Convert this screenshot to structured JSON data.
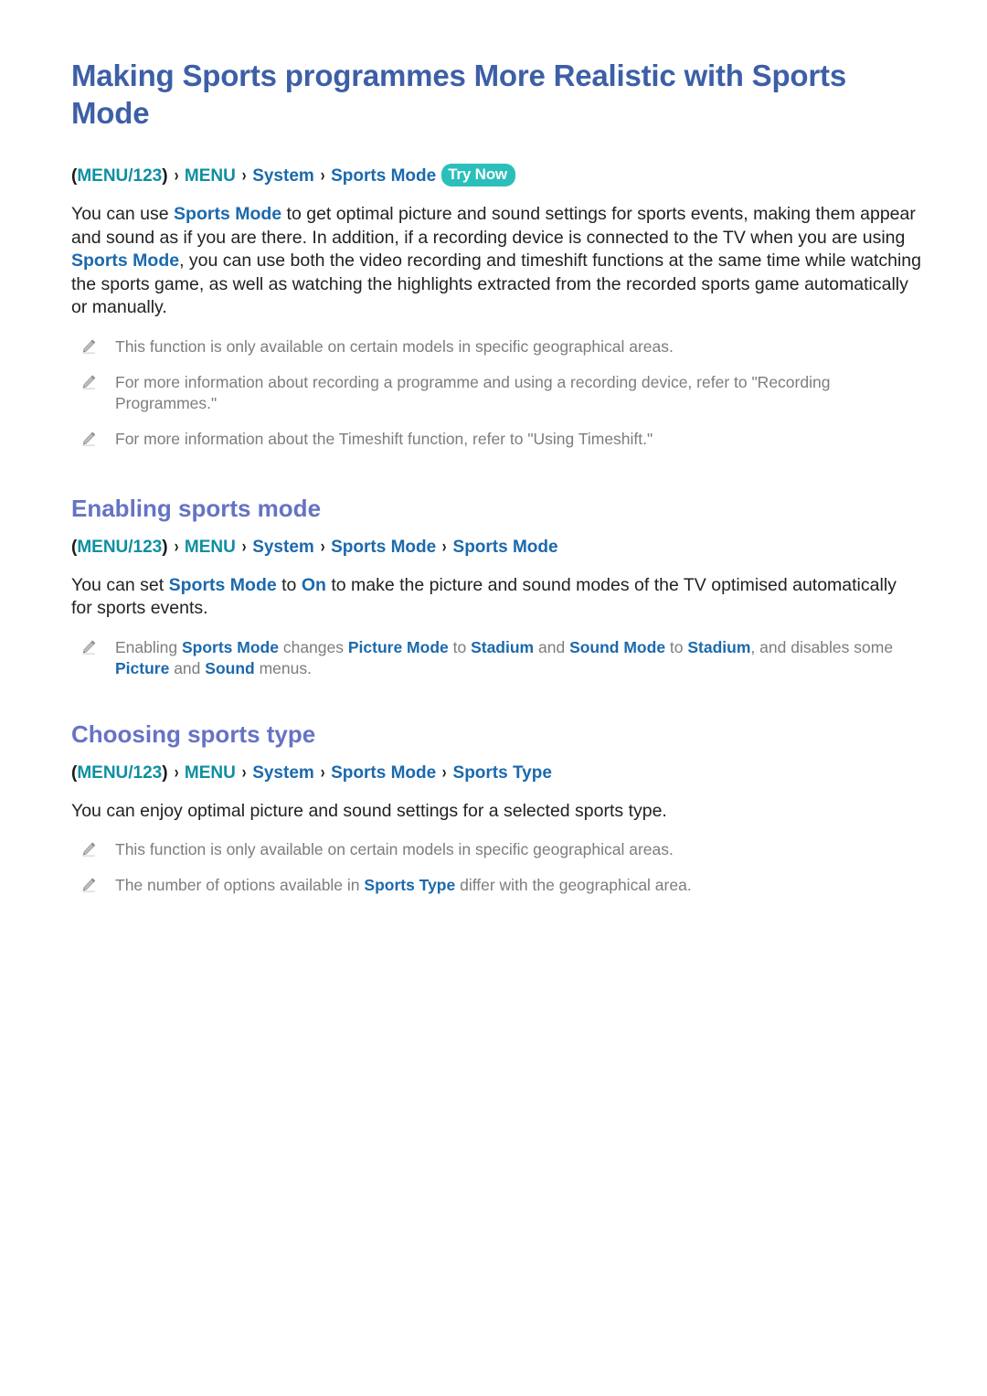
{
  "document": {
    "title": "Making Sports programmes More Realistic with Sports Mode"
  },
  "top_menu_path": {
    "open_paren": "(",
    "menu123": "MENU/123",
    "close_paren": ")",
    "separator": "›",
    "menu": "MENU",
    "system": "System",
    "sports_mode": "Sports Mode",
    "try_now_badge": "Try Now"
  },
  "intro": {
    "p1_a": "You can use ",
    "p1_link1": "Sports Mode",
    "p1_b": " to get optimal picture and sound settings for sports events, making them appear and sound as if you are there. In addition, if a recording device is connected to the TV when you are using ",
    "p1_link2": "Sports Mode",
    "p1_c": ", you can use both the video recording and timeshift functions at the same time while watching the sports game, as well as watching the highlights extracted from the recorded sports game automatically or manually."
  },
  "intro_notes": [
    {
      "icon": "pencil-icon",
      "text": "This function is only available on certain models in specific geographical areas."
    },
    {
      "icon": "pencil-icon",
      "text": "For more information about recording a programme and using a recording device, refer to \"Recording Programmes.\""
    },
    {
      "icon": "pencil-icon",
      "text": "For more information about the Timeshift function, refer to \"Using Timeshift.\""
    }
  ],
  "section_enabling": {
    "heading": "Enabling sports mode",
    "path": {
      "open_paren": "(",
      "menu123": "MENU/123",
      "close_paren": ")",
      "separator": "›",
      "menu": "MENU",
      "system": "System",
      "sports_mode": "Sports Mode",
      "sports_mode_2": "Sports Mode"
    },
    "p_a": "You can set ",
    "p_link1": "Sports Mode",
    "p_b": " to ",
    "p_link2": "On",
    "p_c": " to make the picture and sound modes of the TV optimised automatically for sports events.",
    "note": {
      "icon": "pencil-icon",
      "a": "Enabling ",
      "link1": "Sports Mode",
      "b": " changes ",
      "link2": "Picture Mode",
      "c": " to ",
      "link3": "Stadium",
      "d": " and ",
      "link4": "Sound Mode",
      "e": " to ",
      "link5": "Stadium",
      "f": ", and disables some ",
      "link6": "Picture",
      "g": " and ",
      "link7": "Sound",
      "h": " menus."
    }
  },
  "section_choosing": {
    "heading": "Choosing sports type",
    "path": {
      "open_paren": "(",
      "menu123": "MENU/123",
      "close_paren": ")",
      "separator": "›",
      "menu": "MENU",
      "system": "System",
      "sports_mode": "Sports Mode",
      "sports_type": "Sports Type"
    },
    "p": "You can enjoy optimal picture and sound settings for a selected sports type.",
    "notes": [
      {
        "icon": "pencil-icon",
        "text": "This function is only available on certain models in specific geographical areas."
      },
      {
        "icon": "pencil-icon",
        "a": "The number of options available in ",
        "link": "Sports Type",
        "b": " differ with the geographical area."
      }
    ]
  },
  "colors": {
    "title_blue": "#3d5fa6",
    "heading_purple": "#6573c4",
    "link_blue": "#1b69ad",
    "menu_teal": "#0e8fa2",
    "badge_teal": "#2bbfbb",
    "note_gray": "#7d7d7d",
    "body_black": "#222222",
    "background": "#ffffff"
  }
}
